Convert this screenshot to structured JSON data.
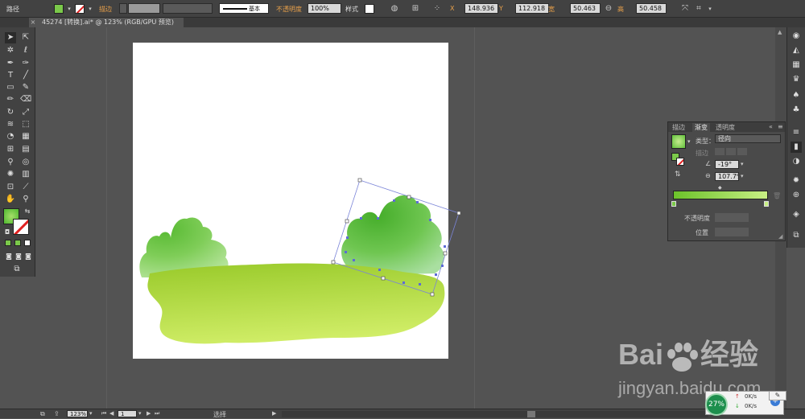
{
  "control_bar": {
    "object_type": "路径",
    "stroke_label": "描边",
    "stroke_weight": "",
    "brush_label": "基本",
    "opacity_label": "不透明度",
    "opacity_value": "100%",
    "style_label": "样式",
    "x_label": "X",
    "x_value": "148.936",
    "y_label": "Y",
    "y_value": "112.918",
    "width_label": "宽",
    "width_value": "50.463",
    "height_label": "高",
    "height_value": "50.458"
  },
  "document_tab": {
    "title": "45274 [转换].ai* @ 123% (RGB/GPU 预览)",
    "close": "×"
  },
  "gradient_panel": {
    "tabs": [
      "描边",
      "渐变",
      "透明度"
    ],
    "type_label": "类型：",
    "type_value": "径向",
    "stroke_label": "描边",
    "angle_value": "-19°",
    "aspect_value": "107.7%",
    "opacity_label": "不透明度",
    "position_label": "位置"
  },
  "status_bar": {
    "zoom": "123%",
    "artboard_num": "1",
    "tool_name": "选择"
  },
  "watermark": {
    "line1": "Bai du 经验",
    "line2": "jingyan.baidu.com"
  },
  "network_widget": {
    "percent": "27%",
    "up": "0K/s",
    "down": "0K/s"
  },
  "colors": {
    "fill_gradient_start": "#a6de6a",
    "fill_gradient_end": "#4db82e",
    "ground_start": "#9ccc2e",
    "ground_end": "#d3ef6a",
    "gradient_bar_start": "#6cc22a",
    "gradient_bar_end": "#c8ef84"
  }
}
